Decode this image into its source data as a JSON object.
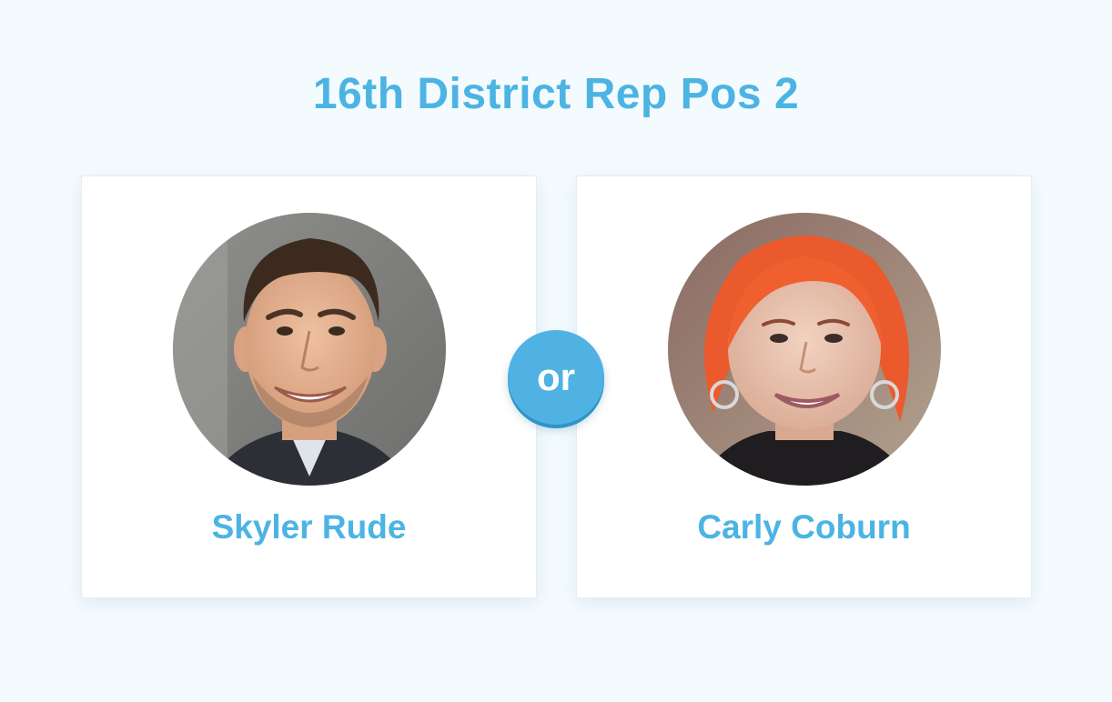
{
  "page": {
    "title": "16th District Rep Pos 2",
    "separator": "or"
  },
  "candidates": [
    {
      "name": "Skyler Rude",
      "photo": "headshot-man"
    },
    {
      "name": "Carly Coburn",
      "photo": "headshot-woman-red-hair"
    }
  ],
  "colors": {
    "accent": "#4cb4e3",
    "background": "#f4fbfe",
    "card": "#ffffff"
  }
}
